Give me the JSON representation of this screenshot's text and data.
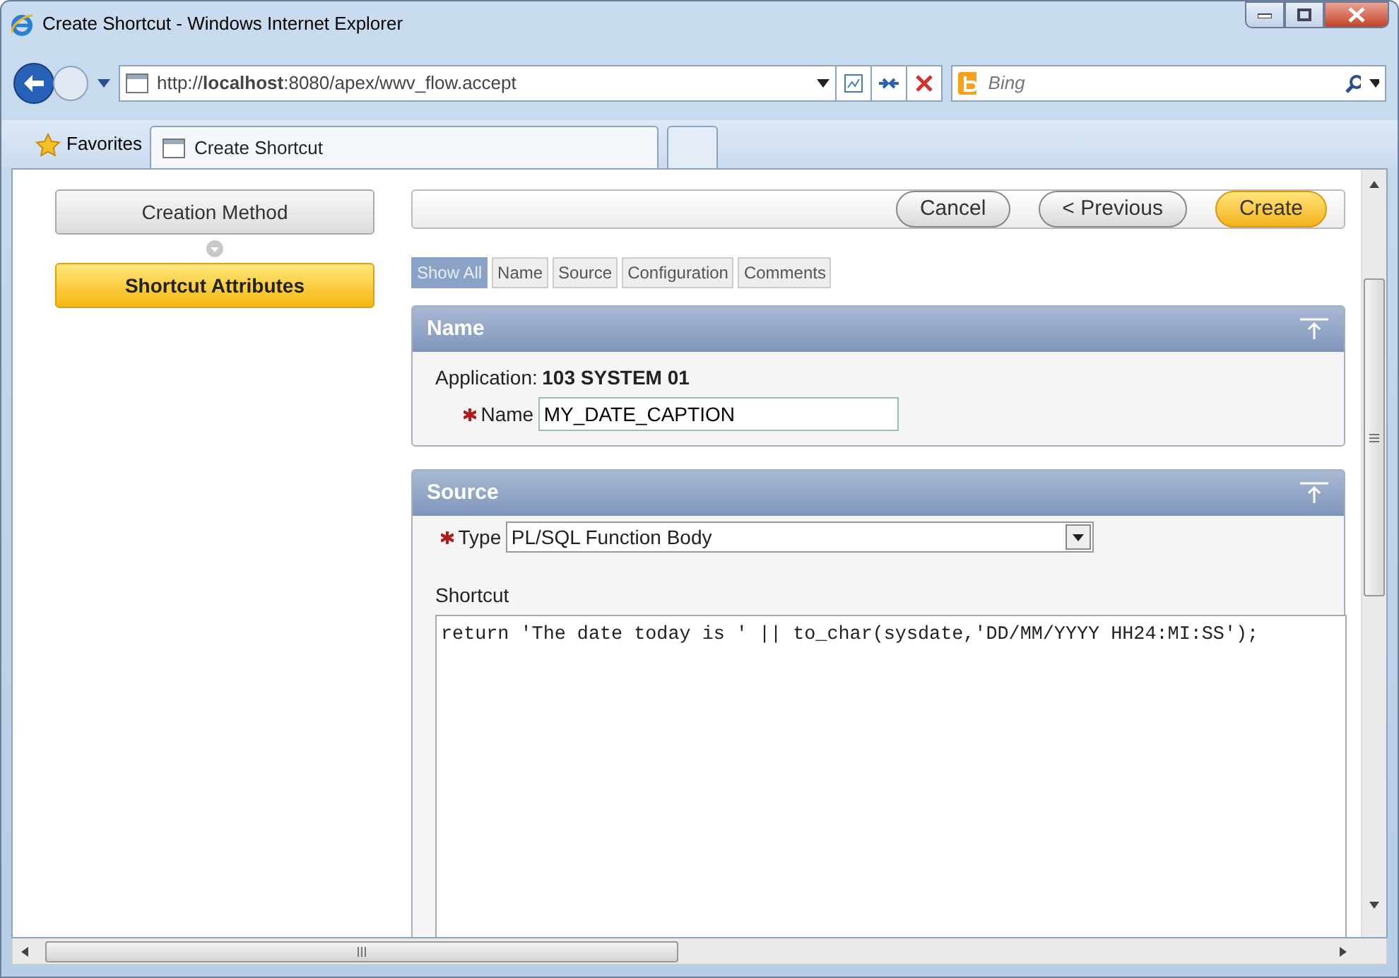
{
  "window": {
    "title": "Create Shortcut - Windows Internet Explorer"
  },
  "address_bar": {
    "url": "http://**localhost**:8080/apex/wwv_flow.accept"
  },
  "search": {
    "placeholder": "Bing"
  },
  "favorites": {
    "label": "Favorites"
  },
  "browser_tabs": [
    {
      "label": "Create Shortcut",
      "selected": true
    }
  ],
  "wizard_steps": [
    {
      "label": "Creation Method",
      "selected": false
    },
    {
      "label": "Shortcut Attributes",
      "selected": true
    }
  ],
  "buttons": [
    {
      "label": "Cancel",
      "kind": "secondary"
    },
    {
      "label": "< Previous",
      "kind": "secondary"
    },
    {
      "label": "Create",
      "kind": "primary"
    }
  ],
  "section_tabs": [
    {
      "label": "Show All",
      "selected": true
    },
    {
      "label": "Name",
      "selected": false
    },
    {
      "label": "Source",
      "selected": false
    },
    {
      "label": "Configuration",
      "selected": false
    },
    {
      "label": "Comments",
      "selected": false
    }
  ],
  "name_region": {
    "title": "Name",
    "application_label": "Application:",
    "application_value": "103 SYSTEM 01",
    "name_label": "Name",
    "name_required": true,
    "name_value": "MY_DATE_CAPTION"
  },
  "source_region": {
    "title": "Source",
    "type_label": "Type",
    "type_required": true,
    "type_value": "PL/SQL Function Body",
    "shortcut_label": "Shortcut",
    "shortcut_value": "return 'The date today is ' || to_char(sysdate,'DD/MM/YYYY HH24:MI:SS');"
  }
}
